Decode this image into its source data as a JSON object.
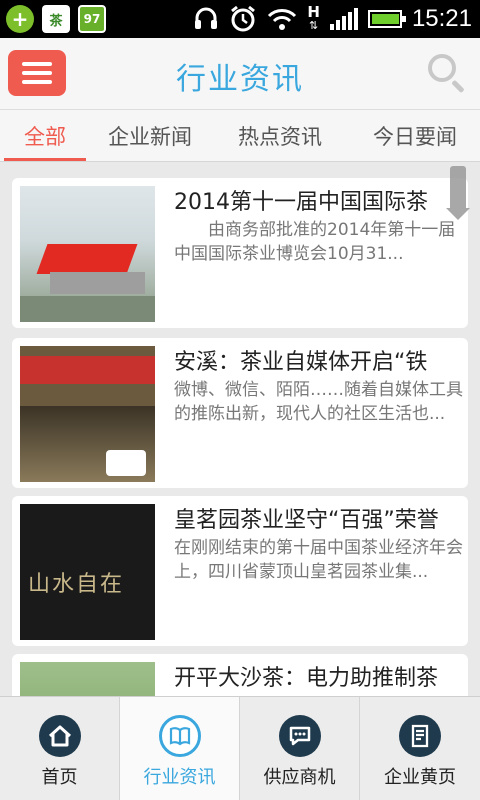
{
  "status_bar": {
    "time": "15:21",
    "icons": [
      "app-plus-icon",
      "tea-app-icon",
      "badge-97-icon",
      "headset-icon",
      "alarm-icon",
      "wifi-icon",
      "hspa-icon",
      "signal-icon",
      "battery-icon"
    ],
    "badge_text": "97",
    "network_label": "H",
    "battery_level": 0.95
  },
  "header": {
    "title": "行业资讯",
    "menu_icon": "hamburger-icon",
    "search_icon": "search-icon",
    "accent_color": "#3aa7de",
    "menu_color": "#ef5b4f"
  },
  "tabs": [
    {
      "label": "全部",
      "active": true
    },
    {
      "label": "企业新闻",
      "active": false
    },
    {
      "label": "热点资讯",
      "active": false
    },
    {
      "label": "今日要闻",
      "active": false
    }
  ],
  "articles": [
    {
      "title": "2014第十一届中国国际茶",
      "desc": "　　由商务部批准的2014年第十一届中国国际茶业博览会10月31..."
    },
    {
      "title": "安溪：茶业自媒体开启“铁",
      "desc": "微博、微信、陌陌……随着自媒体工具的推陈出新，现代人的社区生活也..."
    },
    {
      "title": "皇茗园茶业坚守“百强”荣誉",
      "desc": "在刚刚结束的第十届中国茶业经济年会上，四川省蒙顶山皇茗园茶业集..."
    },
    {
      "title": "开平大沙茶：电力助推制茶",
      "desc": ""
    }
  ],
  "thumb_text": "山水自在",
  "bottom_nav": [
    {
      "label": "首页",
      "icon": "home-icon",
      "active": false
    },
    {
      "label": "行业资讯",
      "icon": "book-icon",
      "active": true
    },
    {
      "label": "供应商机",
      "icon": "chat-icon",
      "active": false
    },
    {
      "label": "企业黄页",
      "icon": "document-icon",
      "active": false
    }
  ]
}
